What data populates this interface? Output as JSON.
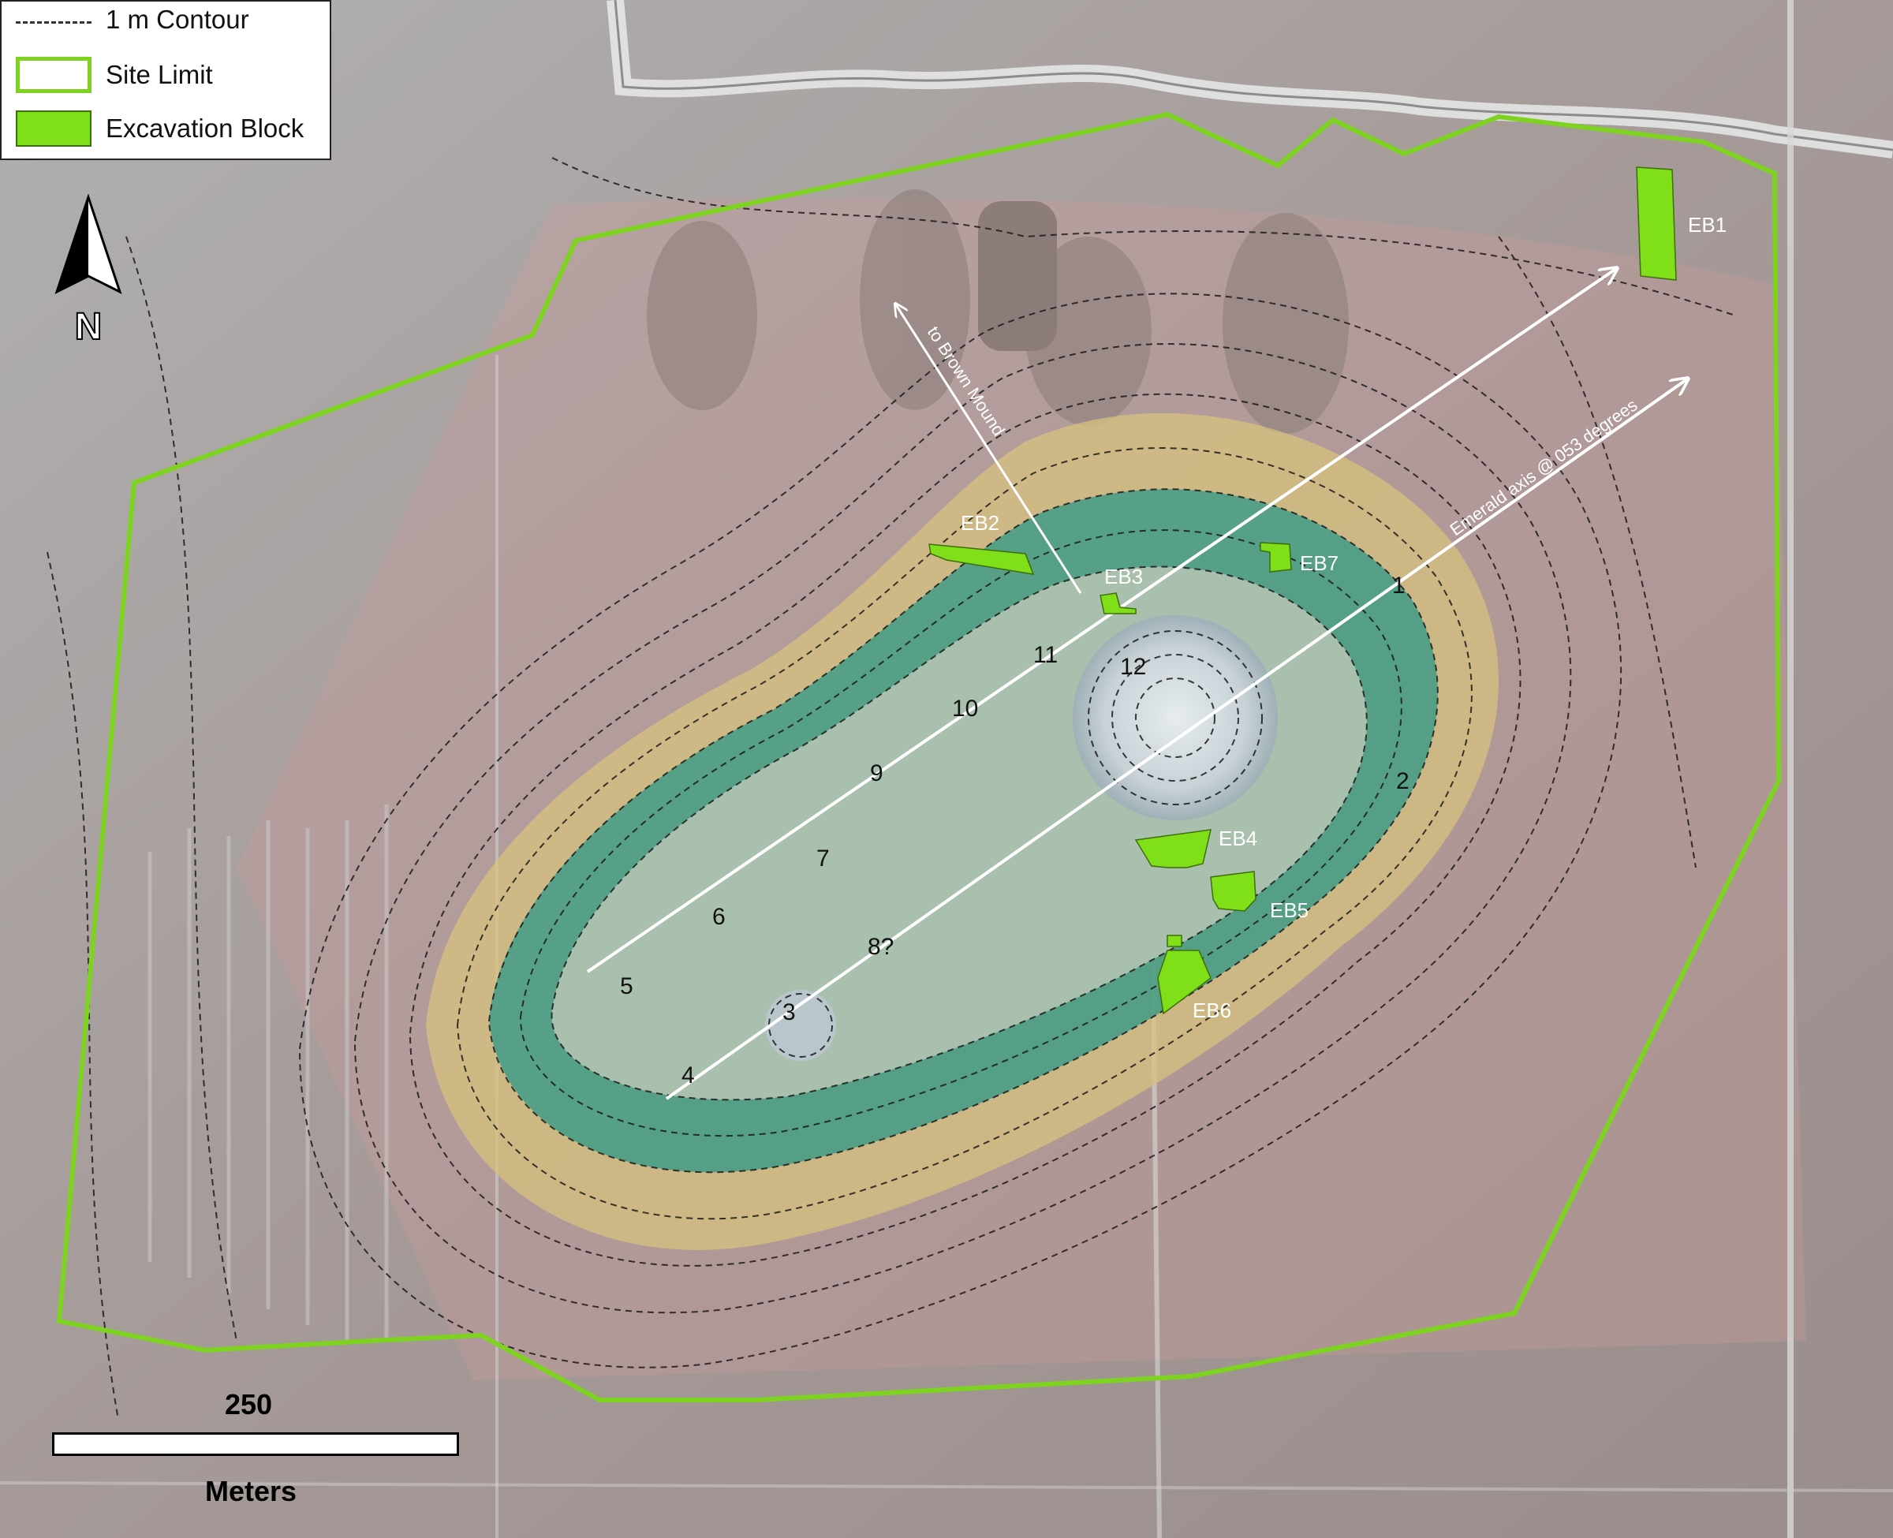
{
  "legend": {
    "contour_label": "1 m Contour",
    "site_limit_label": "Site Limit",
    "excavation_label": "Excavation Block"
  },
  "north_arrow": {
    "label": "N"
  },
  "scale_bar": {
    "value": "250",
    "unit": "Meters"
  },
  "colors": {
    "site_limit": "#7ed321",
    "excavation": "#7fe01a",
    "axis_line": "#ffffff",
    "contour": "#1a1a1a"
  },
  "excavation_blocks": [
    "EB1",
    "EB2",
    "EB3",
    "EB4",
    "EB5",
    "EB6",
    "EB7"
  ],
  "mound_numbers": [
    "1",
    "2",
    "3",
    "4",
    "5",
    "6",
    "7",
    "8?",
    "9",
    "10",
    "11",
    "12"
  ],
  "annotations": {
    "brown_mound": "to Brown Mound",
    "emerald_axis": "Emerald axis @ 053 degrees"
  }
}
